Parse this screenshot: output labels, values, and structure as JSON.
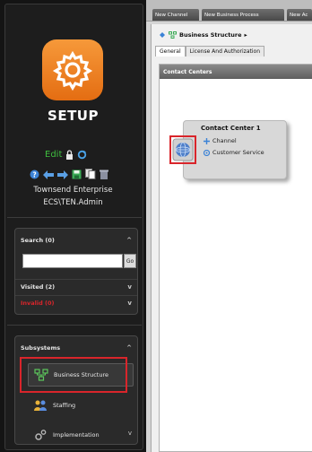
{
  "nav": {
    "title": "SETUP",
    "edit_label": "Edit",
    "user_org": "Townsend Enterprise",
    "user_account": "ECS\\TEN.Admin"
  },
  "search_panel": {
    "search_label": "Search (0)",
    "search_value": "",
    "go_label": "Go",
    "visited_label": "Visited (2)",
    "invalid_label": "Invalid (0)"
  },
  "subsystems": {
    "header": "Subsystems",
    "items": [
      {
        "label": "Business Structure",
        "icon": "business-structure-icon",
        "selected": true
      },
      {
        "label": "Staffing",
        "icon": "staffing-icon",
        "selected": false
      },
      {
        "label": "Implementation",
        "icon": "implementation-icon",
        "selected": false
      }
    ]
  },
  "top_tabs": [
    "New Channel",
    "New Business Process",
    "New Ac"
  ],
  "breadcrumb": "Business Structure",
  "content_tabs": [
    "General",
    "License And Authorization"
  ],
  "contact_centers": {
    "header": "Contact Centers",
    "card_title": "Contact Center 1",
    "items": [
      {
        "label": "Channel"
      },
      {
        "label": "Customer Service"
      }
    ]
  },
  "colors": {
    "accent_orange": "#f08a24",
    "highlight_red": "#d9252b",
    "edit_green": "#3fbf3f",
    "search_label": "#e6e6e6",
    "visited_label": "#e6e6e6",
    "invalid_label": "#d9252b"
  }
}
